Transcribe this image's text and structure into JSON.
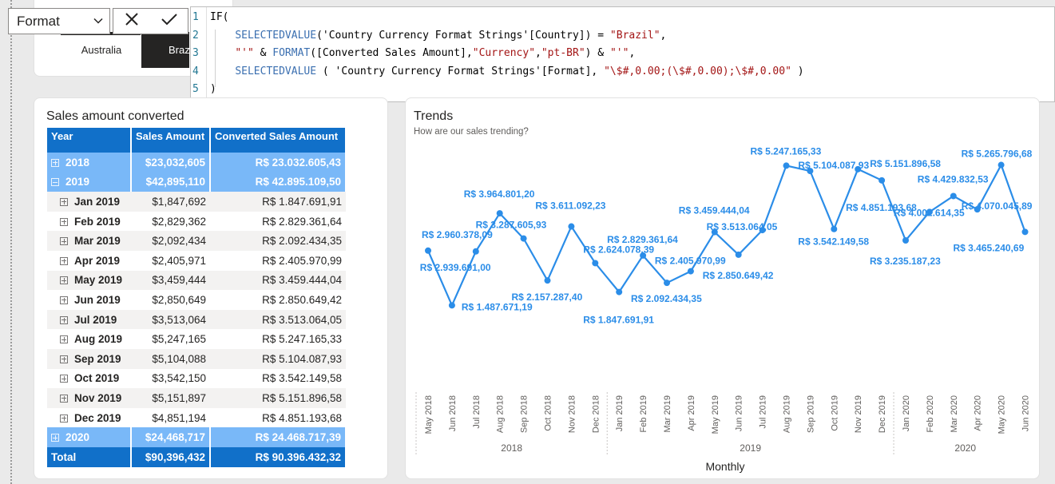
{
  "formula_bar": {
    "field_value": "Format",
    "cancel_icon": "close-icon",
    "commit_icon": "check-icon",
    "lines": [
      {
        "num": "1",
        "html": "IF("
      },
      {
        "num": "2",
        "html": "    SELECTEDVALUE('Country Currency Format Strings'[Country]) = \"Brazil\","
      },
      {
        "num": "3",
        "html": "    \"'\" & FORMAT([Converted Sales Amount],\"Currency\",\"pt-BR\") & \"'\","
      },
      {
        "num": "4",
        "html": "    SELECTEDVALUE ( 'Country Currency Format Strings'[Format], \"\\$#,0.00;(\\$#,0.00);\\$#,0.00\" )"
      },
      {
        "num": "5",
        "html": ")"
      }
    ]
  },
  "slicer": {
    "items": [
      "Australia",
      "Brazil"
    ],
    "selected_visible": "Braz"
  },
  "matrix": {
    "title": "Sales amount converted",
    "headers": [
      "Year",
      "Sales Amount",
      "Converted Sales Amount"
    ],
    "rows": [
      {
        "kind": "yr",
        "expand": "plus",
        "label": "2018",
        "sales": "$23,032,605",
        "conv": "R$ 23.032.605,43"
      },
      {
        "kind": "yr",
        "expand": "minus",
        "label": "2019",
        "sales": "$42,895,110",
        "conv": "R$ 42.895.109,50"
      },
      {
        "kind": "mo",
        "expand": "plus",
        "label": "Jan 2019",
        "sales": "$1,847,692",
        "conv": "R$ 1.847.691,91"
      },
      {
        "kind": "mo",
        "expand": "plus",
        "label": "Feb 2019",
        "sales": "$2,829,362",
        "conv": "R$ 2.829.361,64"
      },
      {
        "kind": "mo",
        "expand": "plus",
        "label": "Mar 2019",
        "sales": "$2,092,434",
        "conv": "R$ 2.092.434,35"
      },
      {
        "kind": "mo",
        "expand": "plus",
        "label": "Apr 2019",
        "sales": "$2,405,971",
        "conv": "R$ 2.405.970,99"
      },
      {
        "kind": "mo",
        "expand": "plus",
        "label": "May 2019",
        "sales": "$3,459,444",
        "conv": "R$ 3.459.444,04"
      },
      {
        "kind": "mo",
        "expand": "plus",
        "label": "Jun 2019",
        "sales": "$2,850,649",
        "conv": "R$ 2.850.649,42"
      },
      {
        "kind": "mo",
        "expand": "plus",
        "label": "Jul 2019",
        "sales": "$3,513,064",
        "conv": "R$ 3.513.064,05"
      },
      {
        "kind": "mo",
        "expand": "plus",
        "label": "Aug 2019",
        "sales": "$5,247,165",
        "conv": "R$ 5.247.165,33"
      },
      {
        "kind": "mo",
        "expand": "plus",
        "label": "Sep 2019",
        "sales": "$5,104,088",
        "conv": "R$ 5.104.087,93"
      },
      {
        "kind": "mo",
        "expand": "plus",
        "label": "Oct 2019",
        "sales": "$3,542,150",
        "conv": "R$ 3.542.149,58"
      },
      {
        "kind": "mo",
        "expand": "plus",
        "label": "Nov 2019",
        "sales": "$5,151,897",
        "conv": "R$ 5.151.896,58"
      },
      {
        "kind": "mo",
        "expand": "plus",
        "label": "Dec 2019",
        "sales": "$4,851,194",
        "conv": "R$ 4.851.193,68"
      },
      {
        "kind": "yr",
        "expand": "plus",
        "label": "2020",
        "sales": "$24,468,717",
        "conv": "R$ 24.468.717,39"
      },
      {
        "kind": "tot",
        "expand": "",
        "label": "Total",
        "sales": "$90,396,432",
        "conv": "R$ 90.396.432,32"
      }
    ]
  },
  "chart_data": {
    "type": "line",
    "title": "Trends",
    "subtitle": "How are our sales trending?",
    "xlabel": "Monthly",
    "ylabel": "",
    "color": "#2b8de8",
    "ylim": [
      1000000,
      5600000
    ],
    "categories": [
      "May 2018",
      "Jun 2018",
      "Jul 2018",
      "Aug 2018",
      "Sep 2018",
      "Oct 2018",
      "Nov 2018",
      "Dec 2018",
      "Jan 2019",
      "Feb 2019",
      "Mar 2019",
      "Apr 2019",
      "May 2019",
      "Jun 2019",
      "Jul 2019",
      "Aug 2019",
      "Sep 2019",
      "Oct 2019",
      "Nov 2019",
      "Dec 2019",
      "Jan 2020",
      "Feb 2020",
      "Mar 2020",
      "Apr 2020",
      "May 2020",
      "Jun 2020"
    ],
    "year_groups": [
      {
        "label": "2018",
        "start": 0,
        "end": 7
      },
      {
        "label": "2019",
        "start": 8,
        "end": 19
      },
      {
        "label": "2020",
        "start": 20,
        "end": 25
      }
    ],
    "series": [
      {
        "values": [
          2960378.09,
          1487671.19,
          2939691.0,
          3964801.2,
          3287605.93,
          2157287.4,
          3611092.23,
          2624078.39,
          1847691.91,
          2829361.64,
          2092434.35,
          2405970.99,
          3459444.04,
          2850649.42,
          3513064.05,
          5247165.33,
          5104087.93,
          3542149.58,
          5151896.58,
          4851193.68,
          3235187.23,
          4002614.35,
          4429832.53,
          4070045.89,
          5265796.68,
          3465240.69
        ],
        "labels": [
          "R$ 2.960.378,09",
          "R$ 1.487.671,19",
          "R$ 2.939.691,00",
          "R$ 3.964.801,20",
          "R$ 3.287.605,93",
          "R$ 2.157.287,40",
          "R$ 3.611.092,23",
          "R$ 2.624.078,39",
          "R$ 1.847.691,91",
          "R$ 2.829.361,64",
          "R$ 2.092.434,35",
          "R$ 2.405.970,99",
          "R$ 3.459.444,04",
          "R$ 2.850.649,42",
          "R$ 3.513.064,05",
          "R$ 5.247.165,33",
          "R$ 5.104.087,93",
          "R$ 3.542.149,58",
          "R$ 5.151.896,58",
          "R$ 4.851.193,68",
          "R$ 3.235.187,23",
          "R$ 4.002.614,35",
          "R$ 4.429.832,53",
          "R$ 4.070.045,89",
          "R$ 5.265.796,68",
          "R$ 3.465.240,69"
        ]
      }
    ]
  }
}
